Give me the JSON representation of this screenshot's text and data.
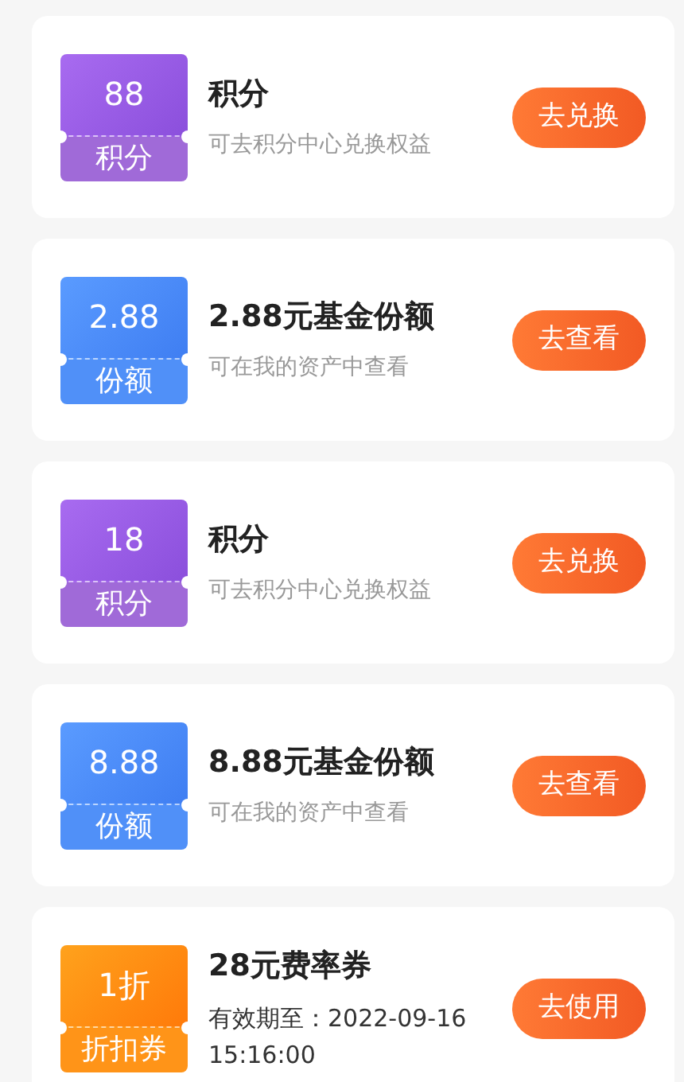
{
  "rewards": [
    {
      "kind": "points",
      "value": "88",
      "unit": "积分",
      "title": "积分",
      "subtitle": "可去积分中心兑换权益",
      "action": "去兑换"
    },
    {
      "kind": "fund",
      "value": "2.88",
      "unit": "份额",
      "title": "2.88元基金份额",
      "subtitle": "可在我的资产中查看",
      "action": "去查看"
    },
    {
      "kind": "points",
      "value": "18",
      "unit": "积分",
      "title": "积分",
      "subtitle": "可去积分中心兑换权益",
      "action": "去兑换"
    },
    {
      "kind": "fund",
      "value": "8.88",
      "unit": "份额",
      "title": "8.88元基金份额",
      "subtitle": "可在我的资产中查看",
      "action": "去查看"
    },
    {
      "kind": "coupon",
      "value": "1折",
      "unit": "折扣券",
      "title": "28元费率券",
      "subtitle": "有效期至：2022-09-16 15:16:00",
      "action": "去使用"
    }
  ]
}
